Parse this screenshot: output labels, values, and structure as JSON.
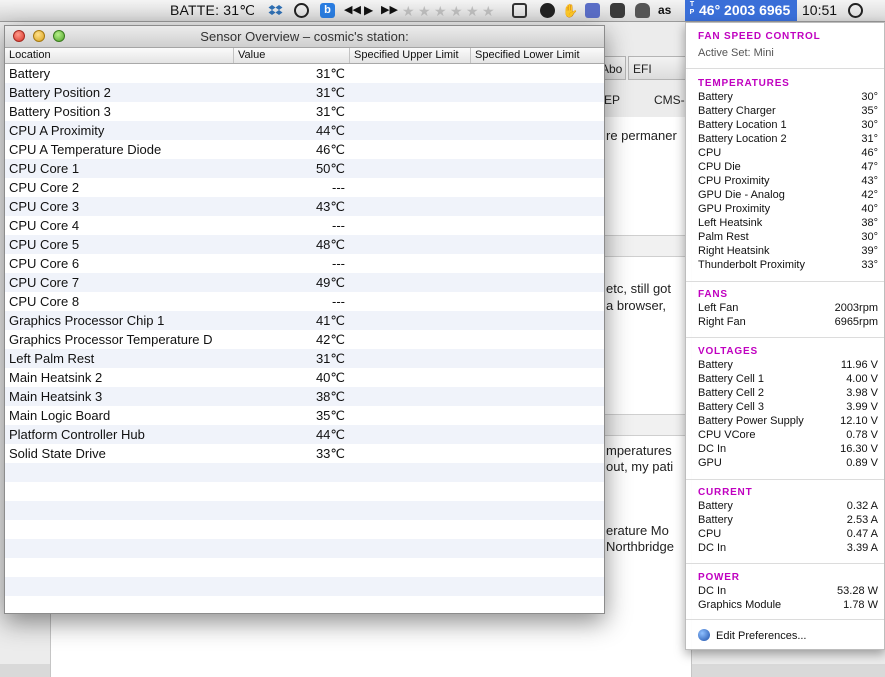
{
  "menubar": {
    "battery_text": "BATTE: 31℃",
    "tgpro_text": "46° 2003 6965",
    "tgpro_badge": "T P",
    "clock": "10:51",
    "icons": [
      "dropbox-icon",
      "sync-icon",
      "b-app-icon",
      "rewind-icon",
      "play-icon",
      "forward-icon",
      "rating-stars",
      "dock-icon",
      "clock-icon",
      "hand-icon",
      "square-icon",
      "evernote-icon",
      "cat-icon",
      "lastfm-icon",
      "tgpro-icon",
      "time-machine-icon"
    ]
  },
  "background": {
    "tabs": [
      "Abo",
      "EFI"
    ],
    "bookmarks": [
      "EP",
      "CMS-"
    ],
    "lines": [
      "re permaner",
      "etc, still got",
      "a browser,",
      "mperatures",
      "out, my pati",
      "erature Mo",
      "Northbridge"
    ]
  },
  "sensor_window": {
    "title": "Sensor Overview – cosmic's station:",
    "columns": [
      "Location",
      "Value",
      "Specified Upper Limit",
      "Specified Lower Limit"
    ],
    "rows": [
      {
        "location": "Battery",
        "value": "31℃"
      },
      {
        "location": "Battery Position 2",
        "value": "31℃"
      },
      {
        "location": "Battery Position 3",
        "value": "31℃"
      },
      {
        "location": "CPU A Proximity",
        "value": "44℃"
      },
      {
        "location": "CPU A Temperature Diode",
        "value": "46℃"
      },
      {
        "location": "CPU Core 1",
        "value": "50℃"
      },
      {
        "location": "CPU Core 2",
        "value": "---"
      },
      {
        "location": "CPU Core 3",
        "value": "43℃"
      },
      {
        "location": "CPU Core 4",
        "value": "---"
      },
      {
        "location": "CPU Core 5",
        "value": "48℃"
      },
      {
        "location": "CPU Core 6",
        "value": "---"
      },
      {
        "location": "CPU Core 7",
        "value": "49℃"
      },
      {
        "location": "CPU Core 8",
        "value": "---"
      },
      {
        "location": "Graphics Processor Chip 1",
        "value": "41℃"
      },
      {
        "location": "Graphics Processor Temperature D",
        "value": "42℃"
      },
      {
        "location": "Left Palm Rest",
        "value": "31℃"
      },
      {
        "location": "Main Heatsink 2",
        "value": "40℃"
      },
      {
        "location": "Main Heatsink 3",
        "value": "38℃"
      },
      {
        "location": "Main Logic Board",
        "value": "35℃"
      },
      {
        "location": "Platform Controller Hub",
        "value": "44℃"
      },
      {
        "location": "Solid State Drive",
        "value": "33℃"
      }
    ]
  },
  "panel": {
    "fan_speed_title": "FAN SPEED CONTROL",
    "active_set": "Active Set: Mini",
    "temperatures_title": "TEMPERATURES",
    "temperatures": [
      {
        "label": "Battery",
        "value": "30°"
      },
      {
        "label": "Battery Charger",
        "value": "35°"
      },
      {
        "label": "Battery Location 1",
        "value": "30°"
      },
      {
        "label": "Battery Location 2",
        "value": "31°"
      },
      {
        "label": "CPU",
        "value": "46°"
      },
      {
        "label": "CPU Die",
        "value": "47°"
      },
      {
        "label": "CPU Proximity",
        "value": "43°"
      },
      {
        "label": "GPU Die - Analog",
        "value": "42°"
      },
      {
        "label": "GPU Proximity",
        "value": "40°"
      },
      {
        "label": "Left Heatsink",
        "value": "38°"
      },
      {
        "label": "Palm Rest",
        "value": "30°"
      },
      {
        "label": "Right Heatsink",
        "value": "39°"
      },
      {
        "label": "Thunderbolt Proximity",
        "value": "33°"
      }
    ],
    "fans_title": "FANS",
    "fans": [
      {
        "label": "Left Fan",
        "value": "2003rpm"
      },
      {
        "label": "Right Fan",
        "value": "6965rpm"
      }
    ],
    "voltages_title": "VOLTAGES",
    "voltages": [
      {
        "label": "Battery",
        "value": "11.96 V"
      },
      {
        "label": "Battery Cell 1",
        "value": "4.00 V"
      },
      {
        "label": "Battery Cell 2",
        "value": "3.98 V"
      },
      {
        "label": "Battery Cell 3",
        "value": "3.99 V"
      },
      {
        "label": "Battery Power Supply",
        "value": "12.10 V"
      },
      {
        "label": "CPU VCore",
        "value": "0.78 V"
      },
      {
        "label": "DC In",
        "value": "16.30 V"
      },
      {
        "label": "GPU",
        "value": "0.89 V"
      }
    ],
    "current_title": "CURRENT",
    "current": [
      {
        "label": "Battery",
        "value": "0.32 A"
      },
      {
        "label": "Battery",
        "value": "2.53 A"
      },
      {
        "label": "CPU",
        "value": "0.47 A"
      },
      {
        "label": "DC In",
        "value": "3.39 A"
      }
    ],
    "power_title": "POWER",
    "power": [
      {
        "label": "DC In",
        "value": "53.28 W"
      },
      {
        "label": "Graphics Module",
        "value": "1.78 W"
      }
    ],
    "edit_preferences": "Edit Preferences..."
  },
  "colors": {
    "tgpro_blue": "#3a6fd8",
    "section_magenta": "#c000c0",
    "row_stripe": "#f0f3fa"
  }
}
